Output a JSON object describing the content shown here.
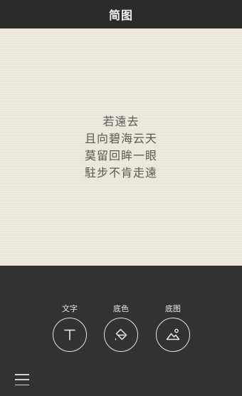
{
  "header": {
    "title": "简图"
  },
  "canvas": {
    "poem_lines": [
      "若遠去",
      "且向碧海云天",
      "莫留回眸一眼",
      "駐步不肯走遠"
    ]
  },
  "toolbar": {
    "tools": [
      {
        "label": "文字",
        "icon": "text-icon"
      },
      {
        "label": "底色",
        "icon": "paint-bucket-icon"
      },
      {
        "label": "底图",
        "icon": "image-icon"
      }
    ],
    "menu_icon": "menu-icon"
  },
  "colors": {
    "header_bg": "#2b2b2a",
    "canvas_bg": "#eeeadf",
    "toolbar_bg": "#323231",
    "poem_text": "#5b5953"
  }
}
